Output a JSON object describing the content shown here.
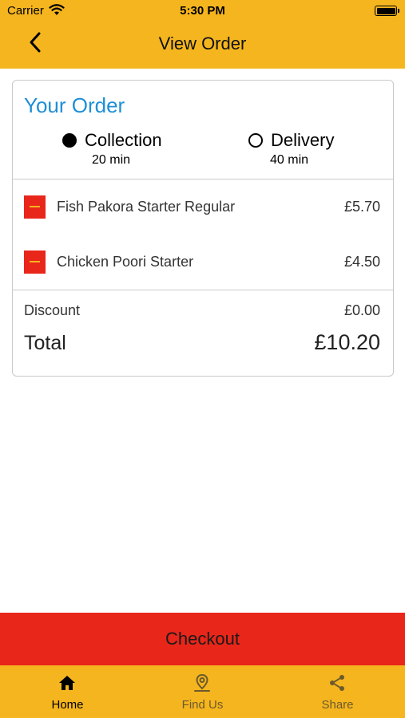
{
  "status_bar": {
    "carrier": "Carrier",
    "time": "5:30 PM"
  },
  "nav": {
    "title": "View Order",
    "back_icon": "chevron-left-icon"
  },
  "order": {
    "title": "Your Order",
    "options": [
      {
        "label": "Collection",
        "time": "20 min",
        "selected": true
      },
      {
        "label": "Delivery",
        "time": "40 min",
        "selected": false
      }
    ],
    "items": [
      {
        "name": "Fish Pakora Starter Regular",
        "price": "£5.70"
      },
      {
        "name": "Chicken Poori Starter",
        "price": "£4.50"
      }
    ],
    "discount_label": "Discount",
    "discount_value": "£0.00",
    "total_label": "Total",
    "total_value": "£10.20"
  },
  "checkout_label": "Checkout",
  "tabs": [
    {
      "label": "Home",
      "icon": "home-icon",
      "active": true
    },
    {
      "label": "Find Us",
      "icon": "map-pin-icon",
      "active": false
    },
    {
      "label": "Share",
      "icon": "share-icon",
      "active": false
    }
  ],
  "colors": {
    "brand_yellow": "#f5b51e",
    "accent_red": "#e8261a",
    "title_blue": "#1f8fd6"
  }
}
